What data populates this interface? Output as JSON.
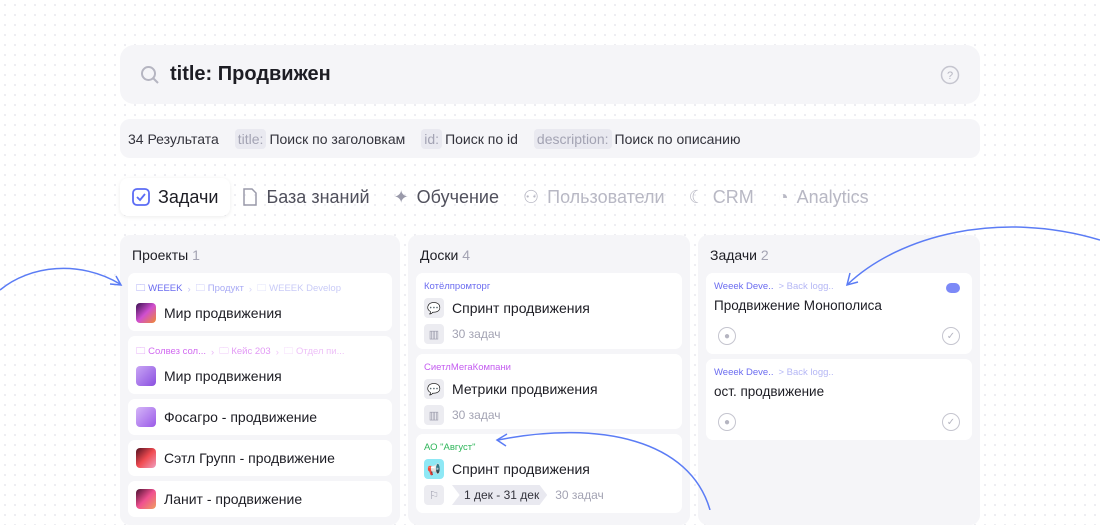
{
  "search": {
    "value": "title: Продвижен",
    "search_icon": "search-icon",
    "help_icon": "help-icon"
  },
  "results": {
    "count": "34 Результата",
    "filters": [
      {
        "prefix": "title:",
        "label": "Поиск по заголовкам"
      },
      {
        "prefix": "id:",
        "label": "Поиск по id"
      },
      {
        "prefix": "description:",
        "label": "Поиск по описанию"
      }
    ]
  },
  "tabs": [
    {
      "label": "Задачи"
    },
    {
      "label": "База знаний"
    },
    {
      "label": "Обучение"
    },
    {
      "label": "Пользователи"
    },
    {
      "label": "CRM"
    },
    {
      "label": "Analytics"
    }
  ],
  "projects": {
    "title": "Проекты",
    "count": "1",
    "items": [
      {
        "crumbs": [
          "WEEEK",
          "Продукт",
          "WEEEK Develop"
        ],
        "name": "Мир продвижения"
      },
      {
        "crumbs": [
          "Солвез сол...",
          "Кейс 203",
          "Отдел пи..."
        ],
        "name": "Мир продвижения"
      },
      {
        "name": "Фосагро - продвижение"
      },
      {
        "name": "Сэтл Групп - продвижение"
      },
      {
        "name": "Ланит - продвижение"
      }
    ]
  },
  "boards": {
    "title": "Доски",
    "count": "4",
    "items": [
      {
        "company": "Котёлпромторг",
        "color": "#6b6cf0",
        "name": "Спринт продвижения",
        "tasks": "30 задач"
      },
      {
        "company": "СиетлМегаКомпани",
        "color": "#c45cf0",
        "name": "Метрики продвижения",
        "tasks": "30 задач"
      },
      {
        "company": "АО \"Август\"",
        "color": "#2fb65a",
        "name": "Спринт продвижения",
        "date": "1 дек - 31 дек",
        "tasks": "30 задач"
      }
    ]
  },
  "tasks": {
    "title": "Задачи",
    "count": "2",
    "items": [
      {
        "project": "Weeek Deve..",
        "board": "> Back logg..",
        "name": "Продвижение Монополиса"
      },
      {
        "project": "Weeek Deve..",
        "board": "> Back logg..",
        "name": "ост. продвижение"
      }
    ]
  },
  "colors": {
    "accent": "#5b6cf5",
    "panel": "#f5f5f8"
  }
}
